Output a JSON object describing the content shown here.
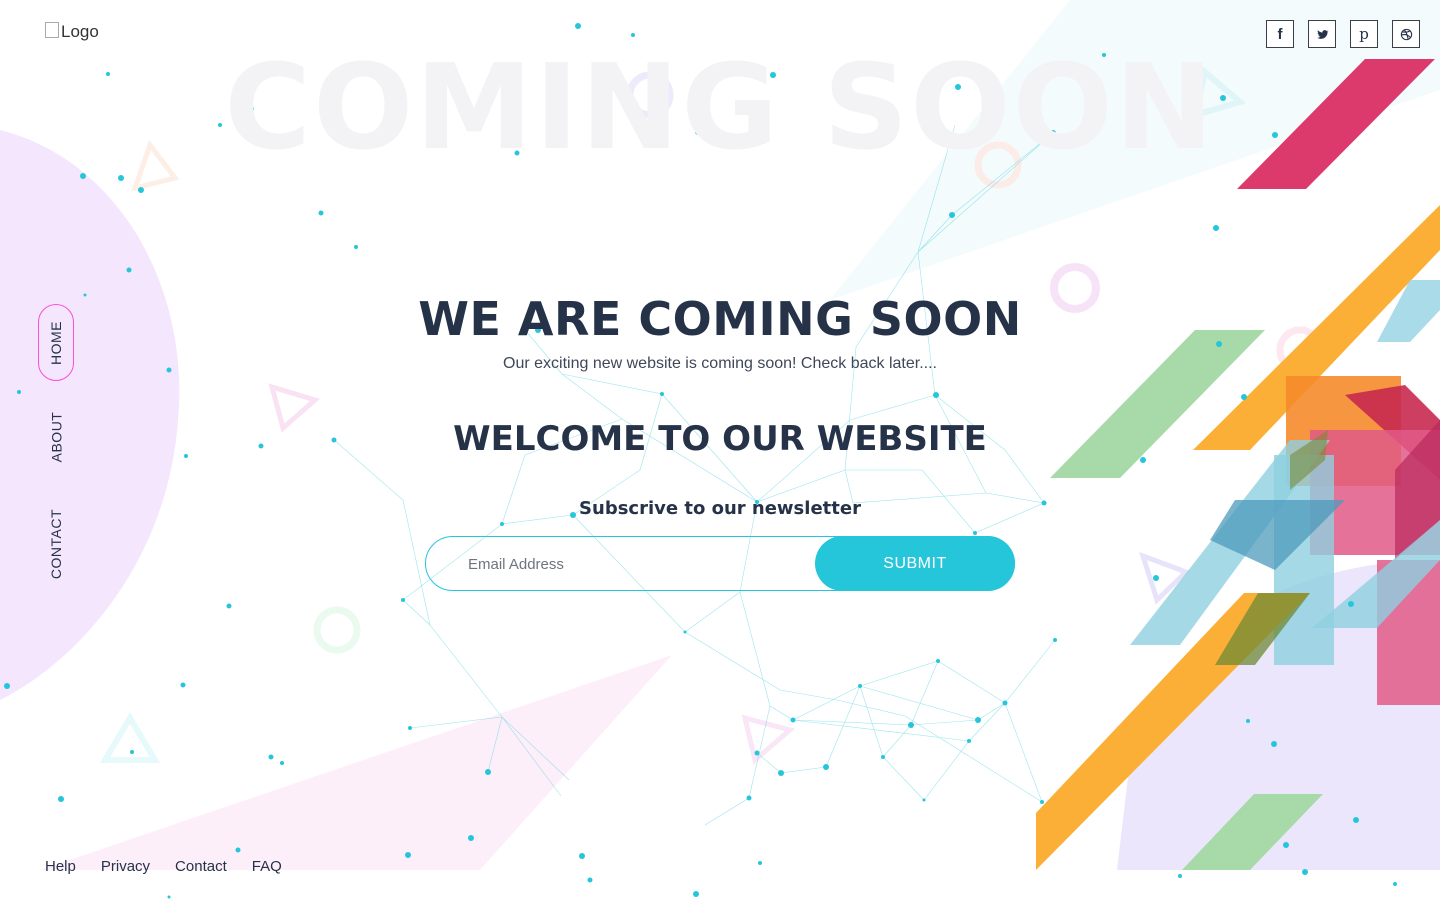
{
  "watermark": "COMING SOON",
  "logo": {
    "alt_text": "Logo"
  },
  "social": [
    {
      "icon": "facebook-icon",
      "glyph": "f"
    },
    {
      "icon": "twitter-icon"
    },
    {
      "icon": "pinterest-icon",
      "glyph": "p"
    },
    {
      "icon": "dribbble-icon"
    }
  ],
  "nav": [
    {
      "label": "HOME",
      "active": true
    },
    {
      "label": "ABOUT",
      "active": false
    },
    {
      "label": "CONTACT",
      "active": false
    }
  ],
  "hero": {
    "title": "WE ARE COMING SOON",
    "subtitle": "Our exciting new website is coming soon! Check back later....",
    "welcome": "WELCOME TO OUR WEBSITE"
  },
  "newsletter": {
    "heading": "Subscrive to our newsletter",
    "email_placeholder": "Email Address",
    "email_value": "",
    "submit_label": "SUBMIT"
  },
  "footer": {
    "links": [
      "Help",
      "Privacy",
      "Contact",
      "FAQ"
    ]
  },
  "colors": {
    "accent": "#26c6da",
    "heading": "#253248",
    "nav_active_border": "#ff4fd2",
    "shape_red": "#dc3a6c",
    "shape_orange": "#fbaf36",
    "shape_green": "#a8d9a9",
    "shape_blue": "#9bd5e4",
    "blob_purple": "#f4e6fd"
  }
}
